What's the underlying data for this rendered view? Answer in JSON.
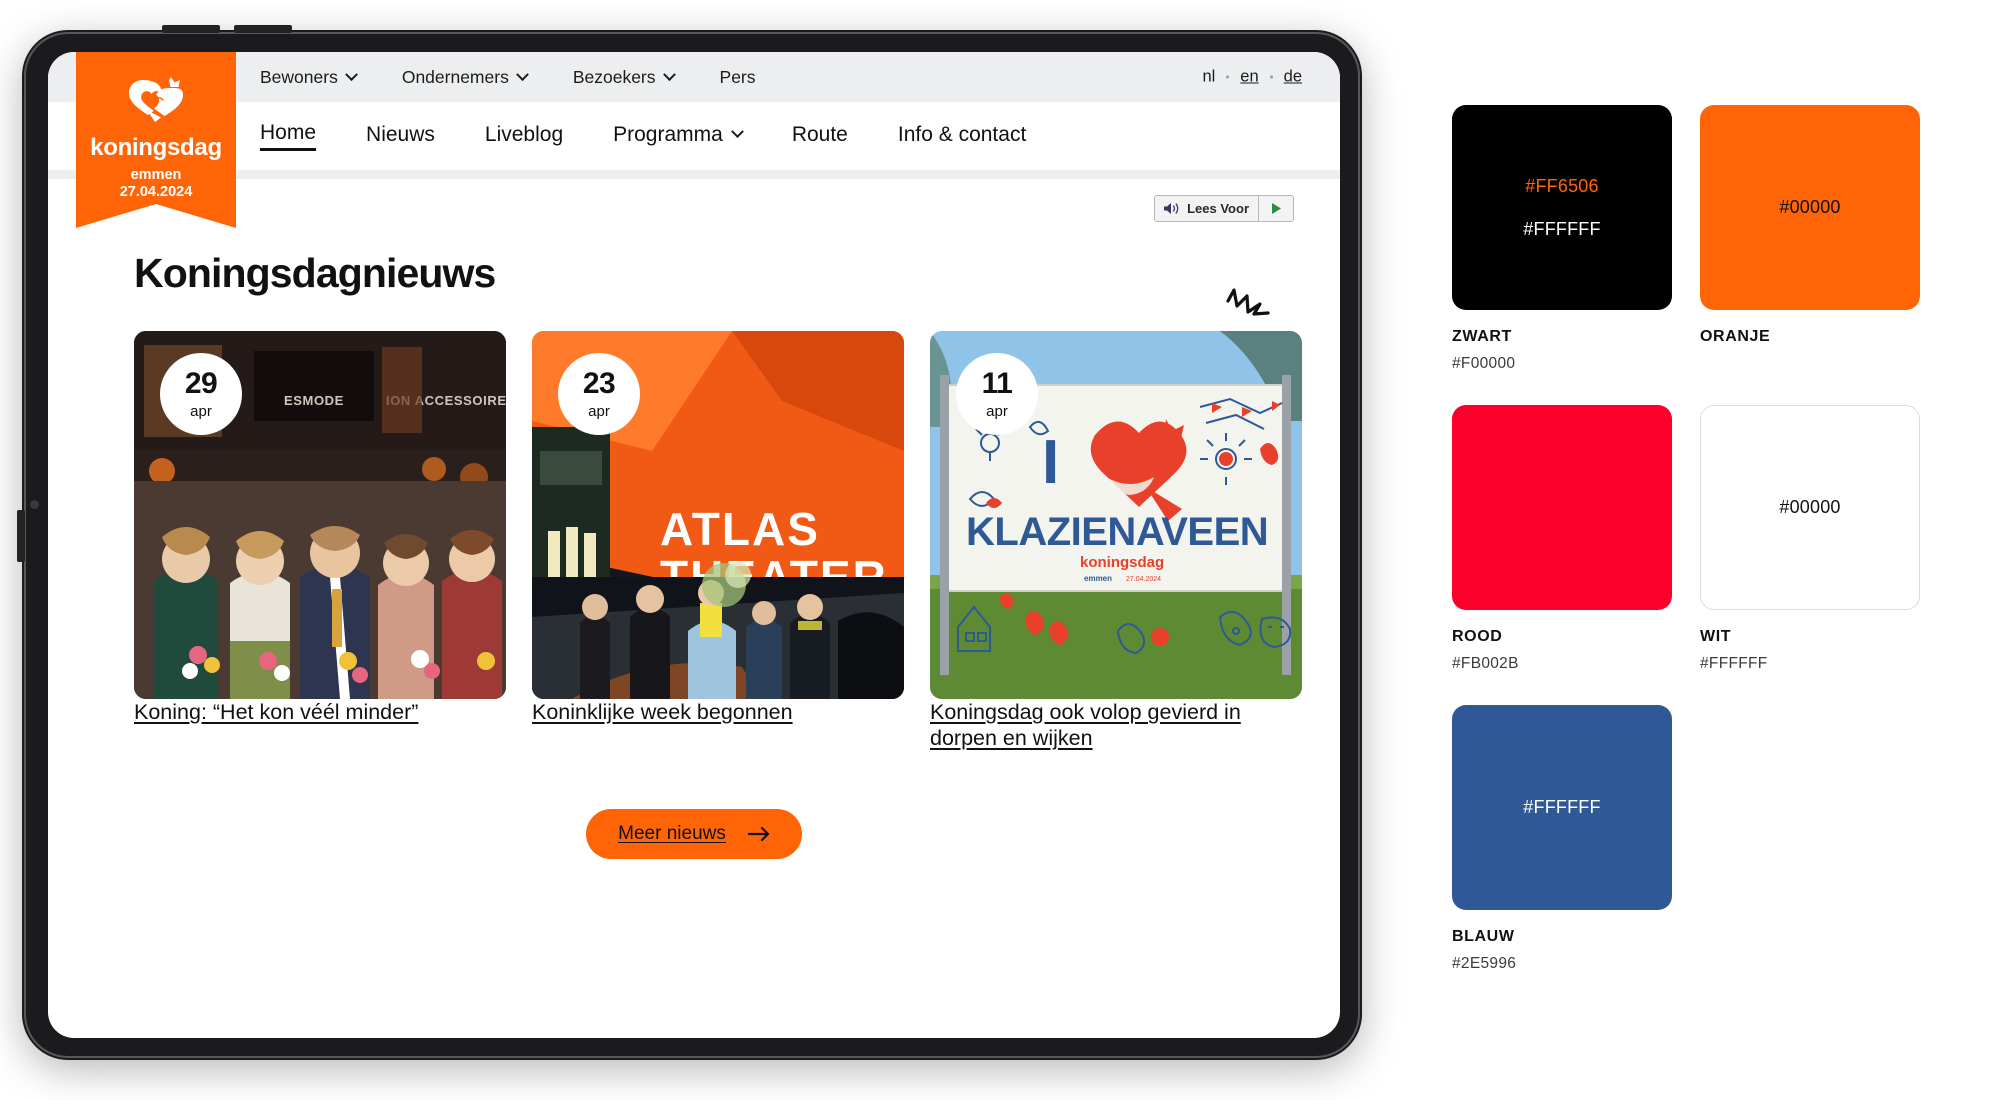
{
  "device": {
    "type": "tablet"
  },
  "site": {
    "logo": {
      "wordmark": "koningsdag",
      "city": "emmen",
      "date": "27.04.2024"
    },
    "topnav": [
      {
        "label": "Bewoners",
        "has_dropdown": true
      },
      {
        "label": "Ondernemers",
        "has_dropdown": true
      },
      {
        "label": "Bezoekers",
        "has_dropdown": true
      },
      {
        "label": "Pers",
        "has_dropdown": false
      }
    ],
    "languages": [
      {
        "code": "nl",
        "active": true,
        "underlined": false
      },
      {
        "code": "en",
        "active": false,
        "underlined": true
      },
      {
        "code": "de",
        "active": false,
        "underlined": true
      }
    ],
    "mainnav": [
      {
        "label": "Home",
        "active": true,
        "has_dropdown": false
      },
      {
        "label": "Nieuws",
        "active": false,
        "has_dropdown": false
      },
      {
        "label": "Liveblog",
        "active": false,
        "has_dropdown": false
      },
      {
        "label": "Programma",
        "active": false,
        "has_dropdown": true
      },
      {
        "label": "Route",
        "active": false,
        "has_dropdown": false
      },
      {
        "label": "Info & contact",
        "active": false,
        "has_dropdown": false
      }
    ],
    "readspeaker": {
      "label": "Lees Voor",
      "play_glyph": "▶"
    },
    "page_title": "Koningsdagnieuws",
    "news_cards": [
      {
        "day": "29",
        "month": "apr",
        "title": "Koning: “Het kon véél minder”",
        "image_alt": "Koninklijke familie in een winkelstraat met publiek"
      },
      {
        "day": "23",
        "month": "apr",
        "title": "Koninklijke week begonnen",
        "image_alt": "Atlas Theater met koninklijk gezelschap bij avond",
        "image_text": [
          "ATLAS",
          "THEATER"
        ]
      },
      {
        "day": "11",
        "month": "apr",
        "title": "Koningsdag ook volop gevierd in dorpen en wijken",
        "image_alt": "Spandoek I love Klazienaveen",
        "banner": {
          "line1": "I",
          "line2": "KLAZIENAVEEN",
          "brand": "koningsdag",
          "sub_city": "emmen",
          "sub_date": "27.04.2024"
        }
      }
    ],
    "more_news_button": {
      "label": "Meer nieuws",
      "arrow_glyph": "→"
    }
  },
  "palette": {
    "swatches": [
      {
        "name": "ZWART",
        "hex_label": "#F00000",
        "box_color": "#000000",
        "bordered": false,
        "inner_texts": [
          {
            "text": "#FF6506",
            "color": "#FF6506"
          },
          {
            "text": "#FFFFFF",
            "color": "#FFFFFF"
          }
        ]
      },
      {
        "name": "ORANJE",
        "hex_label": "",
        "box_color": "#FF6506",
        "bordered": false,
        "inner_texts": [
          {
            "text": "#00000",
            "color": "#111111"
          }
        ]
      },
      {
        "name": "ROOD",
        "hex_label": "#FB002B",
        "box_color": "#FB002B",
        "bordered": false,
        "inner_texts": []
      },
      {
        "name": "WIT",
        "hex_label": "#FFFFFF",
        "box_color": "#FFFFFF",
        "bordered": true,
        "inner_texts": [
          {
            "text": "#00000",
            "color": "#111111"
          }
        ]
      },
      {
        "name": "BLAUW",
        "hex_label": "#2E5996",
        "box_color": "#2E5996",
        "bordered": false,
        "inner_texts": [
          {
            "text": "#FFFFFF",
            "color": "#FFFFFF"
          }
        ]
      }
    ]
  }
}
